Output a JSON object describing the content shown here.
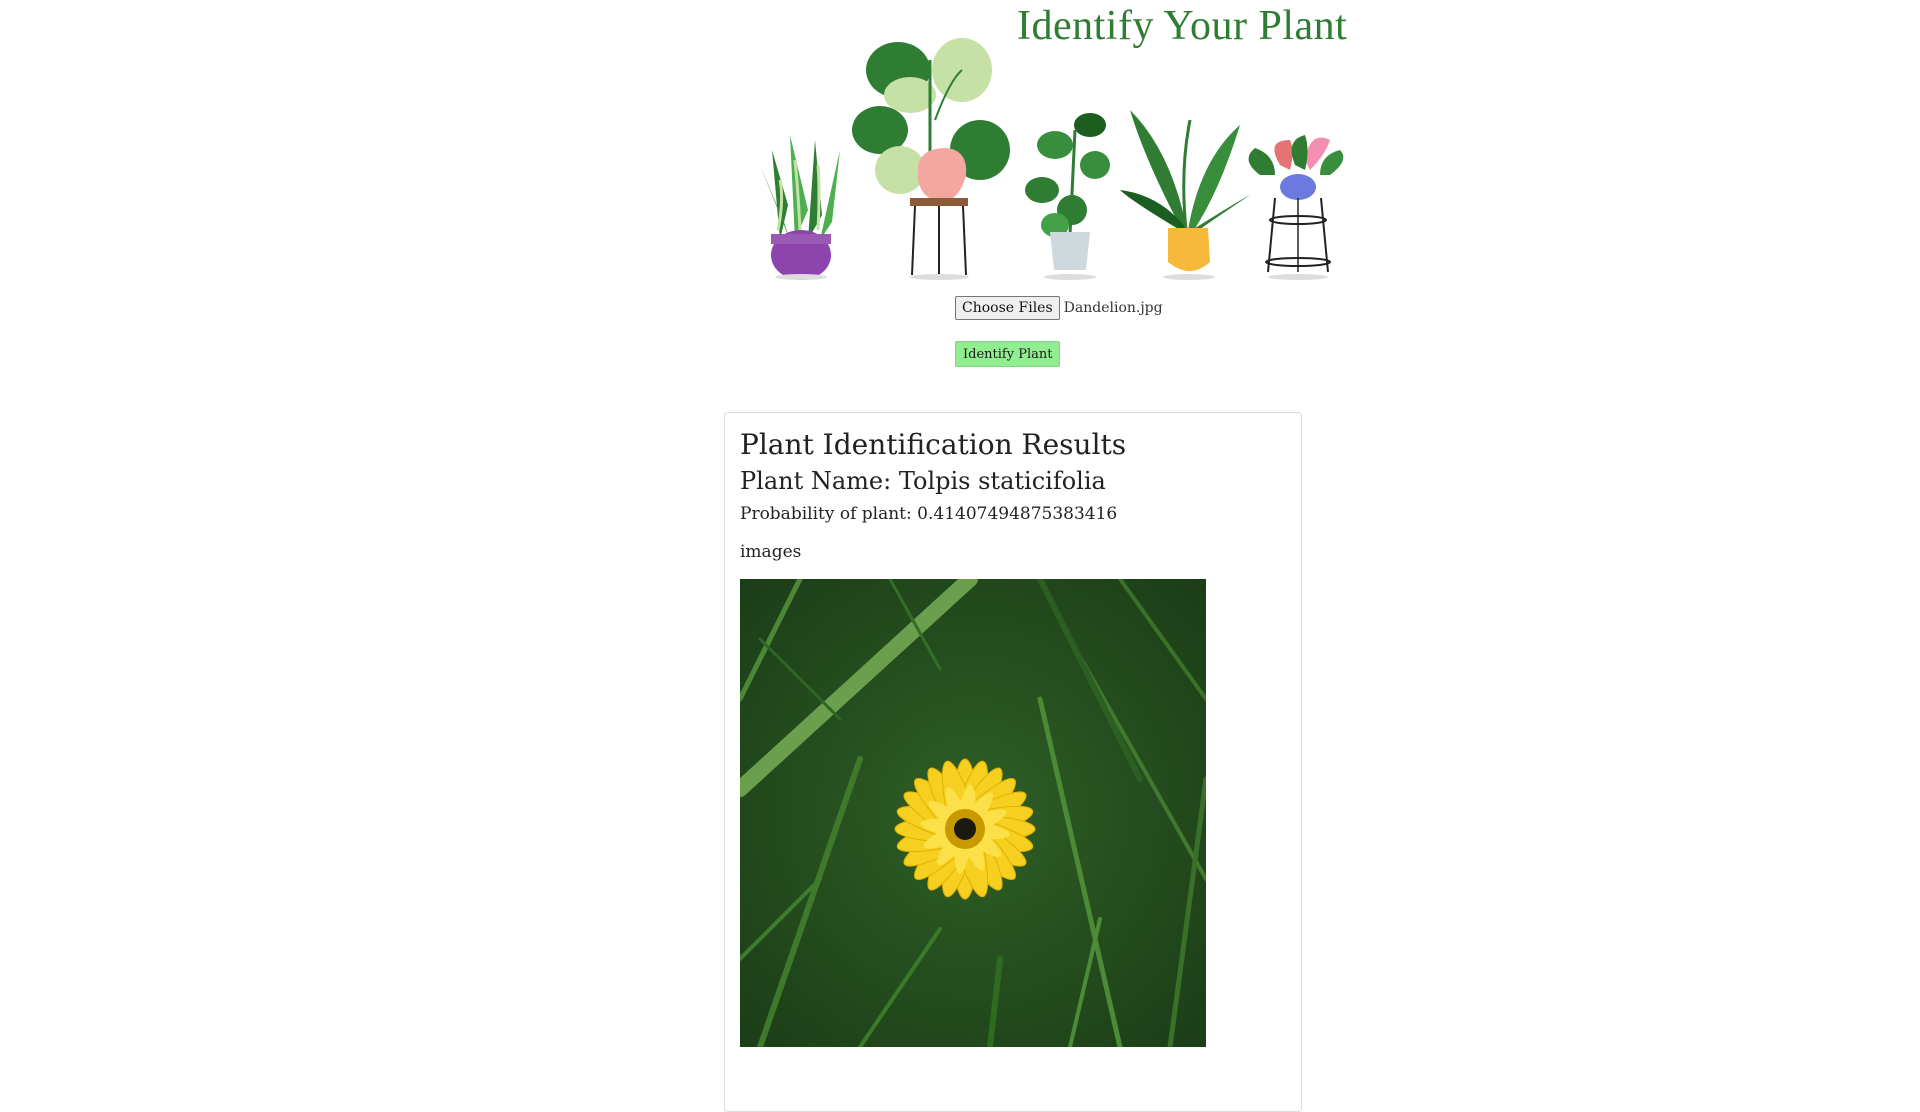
{
  "header": {
    "title": "Identify Your Plant",
    "banner_icon": "potted-plants-illustration"
  },
  "upload": {
    "choose_files_label": "Choose Files",
    "selected_file": "Dandelion.jpg"
  },
  "actions": {
    "identify_label": "Identify Plant"
  },
  "results": {
    "title": "Plant Identification Results",
    "plant_name_label": "Plant Name:",
    "plant_name": "Tolpis staticifolia",
    "probability_label": "Probability of plant:",
    "probability": "0.41407494875383416",
    "images_label": "images",
    "image_icon": "yellow-flower-photo"
  },
  "colors": {
    "title_green": "#2e7d32",
    "button_green": "#90ee90"
  }
}
